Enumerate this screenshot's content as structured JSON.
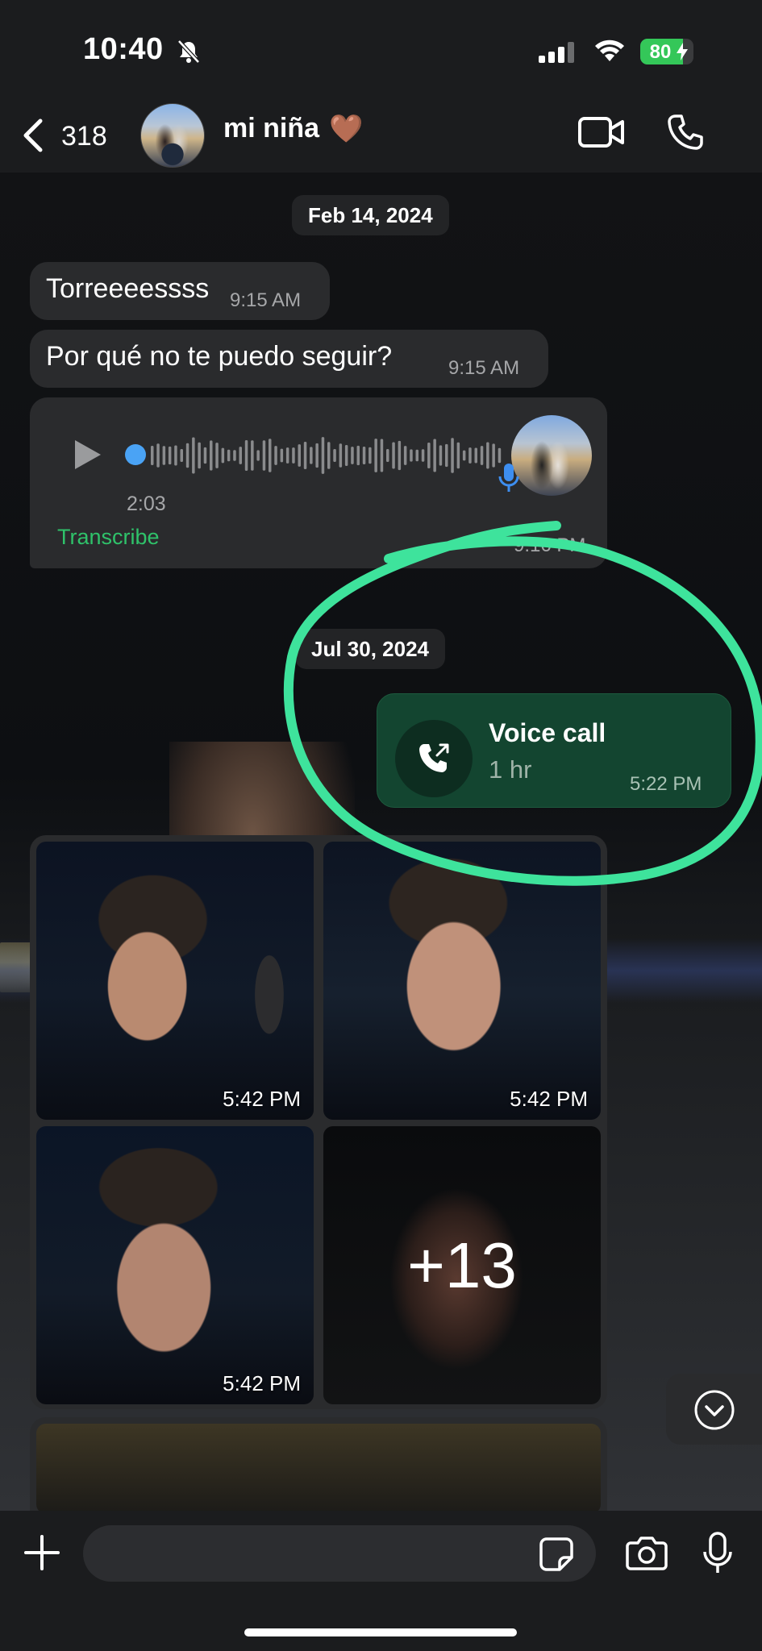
{
  "status_bar": {
    "time": "10:40",
    "battery": "80",
    "battery_level": 0.8,
    "icons": [
      "bell-slash-icon",
      "cellular-signal-icon",
      "wifi-icon",
      "battery-charging-icon"
    ]
  },
  "header": {
    "back_count": "318",
    "contact_name": "mi niña",
    "contact_emoji": "🤎",
    "icons": [
      "chevron-left-icon",
      "video-camera-icon",
      "phone-icon"
    ]
  },
  "chat": {
    "date_1": "Feb 14, 2024",
    "messages": [
      {
        "text": "Torreeeessss",
        "time": "9:15 AM"
      },
      {
        "text": "Por qué no te puedo seguir?",
        "time": "9:15 AM"
      }
    ],
    "voice_note": {
      "duration": "2:03",
      "transcribe_label": "Transcribe",
      "time": "9:16 PM"
    },
    "date_2": "Jul 30, 2024",
    "call": {
      "title": "Voice call",
      "duration": "1 hr",
      "time": "5:22 PM"
    },
    "photos": [
      {
        "time": "5:42 PM"
      },
      {
        "time": "5:42 PM"
      },
      {
        "time": "5:42 PM"
      },
      {
        "more": "+13"
      }
    ]
  },
  "input_bar": {
    "placeholder": "",
    "icons": [
      "plus-icon",
      "sticker-icon",
      "camera-icon",
      "microphone-icon"
    ]
  },
  "colors": {
    "accent_green": "#2fc26a",
    "call_bubble": "#134530",
    "annotation_stroke": "#3ee39c",
    "voice_blue": "#4aa3f5"
  }
}
